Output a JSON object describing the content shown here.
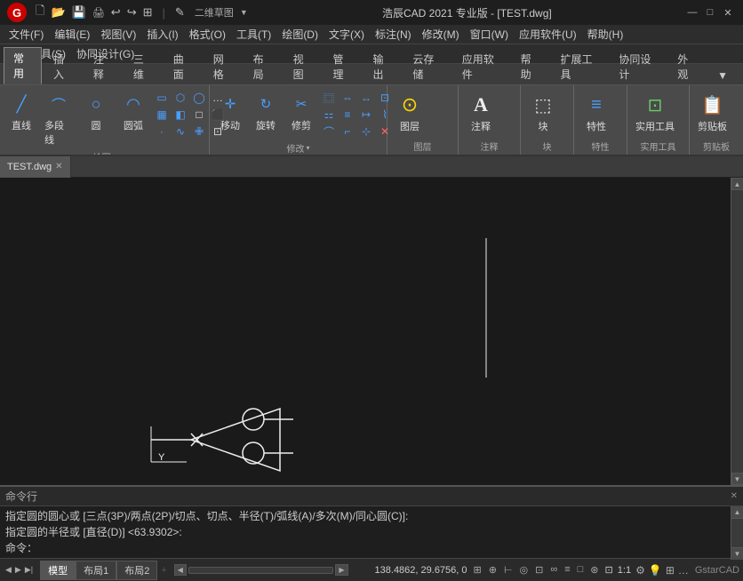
{
  "titlebar": {
    "logo": "G",
    "title": "浩辰CAD 2021 专业版 - [TEST.dwg]",
    "toolbar_icons": [
      "🗋",
      "🗁",
      "💾",
      "🖨",
      "↩",
      "↪",
      "⊞",
      "✏"
    ],
    "dropdown_label": "二维草图",
    "win_btns": [
      "—",
      "□",
      "✕"
    ]
  },
  "menubar": {
    "items": [
      "文件(F)",
      "编辑(E)",
      "视图(V)",
      "插入(I)",
      "格式(O)",
      "工具(T)",
      "绘图(D)",
      "文字(X)",
      "标注(N)",
      "修改(M)",
      "窗口(W)",
      "应用软件(U)",
      "帮助(H)"
    ]
  },
  "ext_toolbar": {
    "items": [
      "扩展工具(S)",
      "协同设计(G)"
    ]
  },
  "ribbon_tabs": {
    "tabs": [
      "常用",
      "插入",
      "注释",
      "三维",
      "曲面",
      "网格",
      "布局",
      "视图",
      "管理",
      "输出",
      "云存储",
      "应用软件",
      "帮助",
      "扩展工具",
      "协同设计",
      "外观",
      "▼"
    ]
  },
  "ribbon": {
    "groups": [
      {
        "name": "绘图",
        "label": "绘图",
        "has_arrow": true
      },
      {
        "name": "修改",
        "label": "修改",
        "has_arrow": true
      },
      {
        "name": "图层",
        "label": "图层"
      },
      {
        "name": "注释",
        "label": "注释"
      },
      {
        "name": "块",
        "label": "块"
      },
      {
        "name": "特性",
        "label": "特性"
      },
      {
        "name": "实用工具",
        "label": "实用工具"
      },
      {
        "name": "剪贴板",
        "label": "剪贴板"
      }
    ]
  },
  "doc_tab": {
    "name": "TEST.dwg"
  },
  "command": {
    "header": "命令行",
    "lines": [
      "指定圆的圆心或 [三点(3P)/两点(2P)/切点、切点、半径(T)/弧线(A)/多次(M)/同心圆(C)]:",
      "指定圆的半径或 [直径(D)] <63.9302>:",
      "命令："
    ]
  },
  "statusbar": {
    "coords": "138.4862, 29.6756, 0",
    "model_tabs": [
      "模型",
      "布局1",
      "布局2"
    ],
    "scale": "1:1",
    "right_label": "GstarCAD"
  },
  "drawing": {
    "bgcolor": "#1a1a1a"
  }
}
